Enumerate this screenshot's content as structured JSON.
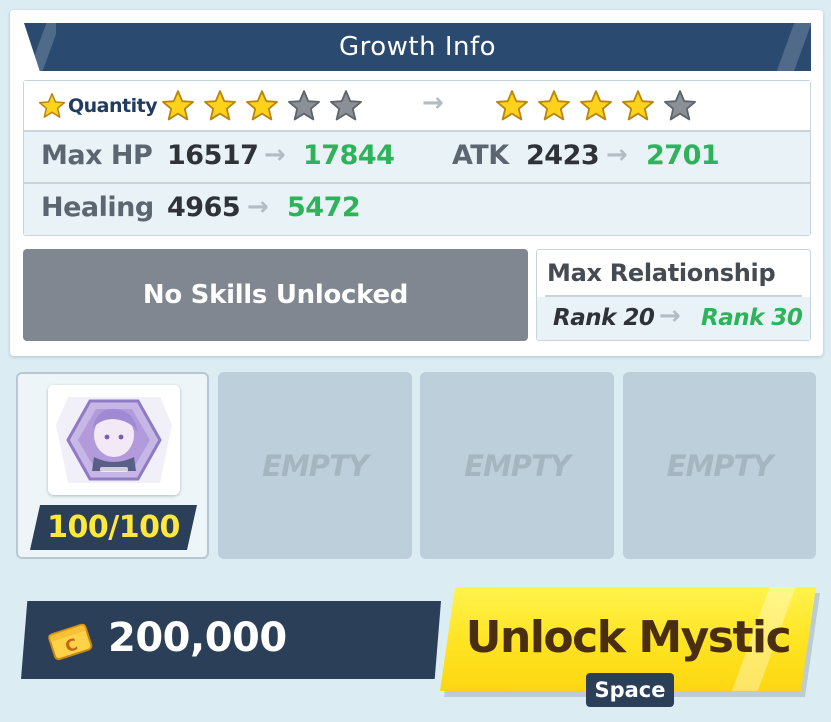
{
  "growth_info": {
    "title": "Growth Info",
    "quantity": {
      "label": "Quantity",
      "current_stars": 3,
      "next_stars": 4,
      "max_stars": 5,
      "arrow": "→"
    },
    "stats": [
      {
        "label": "Max HP",
        "current": "16517",
        "next": "17844"
      },
      {
        "label": "ATK",
        "current": "2423",
        "next": "2701"
      },
      {
        "label": "Healing",
        "current": "4965",
        "next": "5472"
      }
    ]
  },
  "skills": {
    "label": "No Skills Unlocked"
  },
  "relationship": {
    "title": "Max Relationship",
    "current": "Rank 20",
    "next": "Rank 30"
  },
  "slots": {
    "filled": {
      "count": "100/100",
      "icon": "character-eleph-icon"
    },
    "empty_label": "EMPTY",
    "empty": [
      "EMPTY",
      "EMPTY",
      "EMPTY"
    ]
  },
  "cost": {
    "icon": "credit-card-icon",
    "amount": "200,000"
  },
  "unlock_button": {
    "label": "Unlock Mystic",
    "key": "Space"
  },
  "colors": {
    "title_bar": "#2a4a70",
    "increase_green": "#2eb35a",
    "count_yellow": "#ffe83c",
    "button_yellow": "#ffe321",
    "dark_navy": "#2b3f59"
  }
}
